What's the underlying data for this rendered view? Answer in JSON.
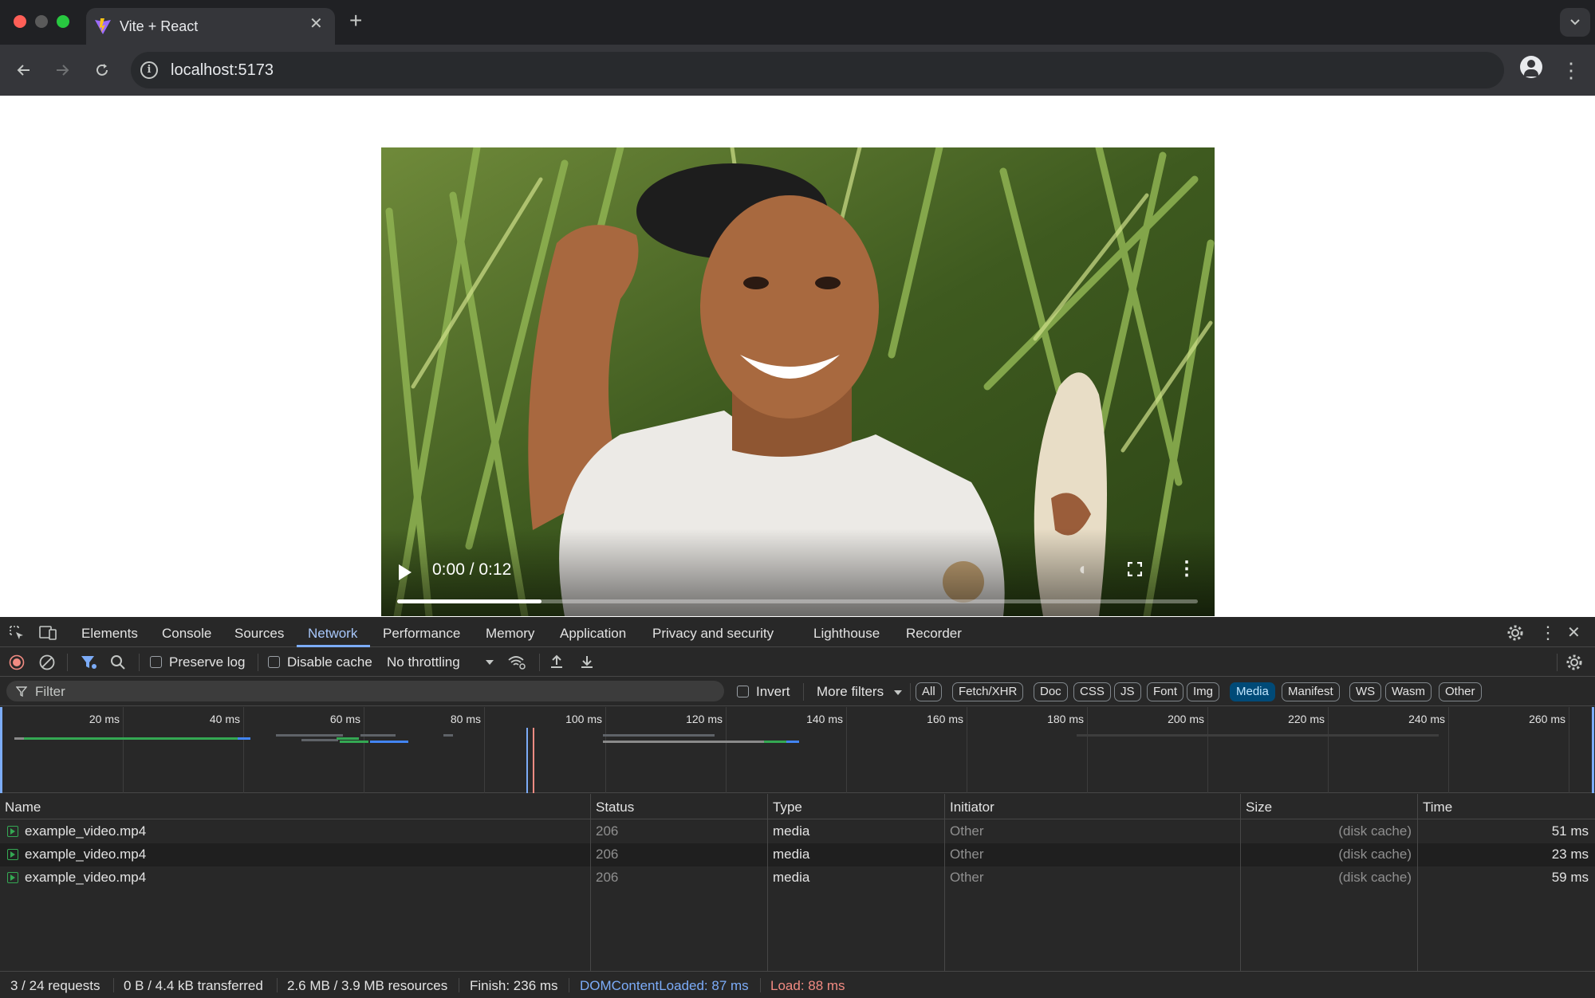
{
  "tab": {
    "title": "Vite + React",
    "close": "✕"
  },
  "new_tab": "+",
  "address": {
    "url": "localhost:5173"
  },
  "video": {
    "time": "0:00 / 0:12",
    "progress_buffered": 0.18
  },
  "devtools": {
    "tabs": [
      "Elements",
      "Console",
      "Sources",
      "Network",
      "Performance",
      "Memory",
      "Application",
      "Privacy and security",
      "Lighthouse",
      "Recorder"
    ],
    "active_tab": "Network",
    "toolbar": {
      "preserve_log": "Preserve log",
      "disable_cache": "Disable cache",
      "throttling": "No throttling"
    },
    "filter": {
      "placeholder": "Filter",
      "invert": "Invert",
      "more_filters": "More filters",
      "types": [
        "All",
        "Fetch/XHR",
        "Doc",
        "CSS",
        "JS",
        "Font",
        "Img",
        "Media",
        "Manifest",
        "WS",
        "Wasm",
        "Other"
      ],
      "active_type": "Media"
    },
    "timeline": {
      "ticks": [
        "20 ms",
        "40 ms",
        "60 ms",
        "80 ms",
        "100 ms",
        "120 ms",
        "140 ms",
        "160 ms",
        "180 ms",
        "200 ms",
        "220 ms",
        "240 ms",
        "260 ms"
      ],
      "dom_content_loaded_ms": 87,
      "load_ms": 88,
      "colors": {
        "dcl": "#7cacf8",
        "load": "#f28b82"
      }
    },
    "table": {
      "columns": [
        "Name",
        "Status",
        "Type",
        "Initiator",
        "Size",
        "Time"
      ],
      "rows": [
        {
          "name": "example_video.mp4",
          "status": "206",
          "type": "media",
          "initiator": "Other",
          "size": "(disk cache)",
          "time": "51 ms"
        },
        {
          "name": "example_video.mp4",
          "status": "206",
          "type": "media",
          "initiator": "Other",
          "size": "(disk cache)",
          "time": "23 ms"
        },
        {
          "name": "example_video.mp4",
          "status": "206",
          "type": "media",
          "initiator": "Other",
          "size": "(disk cache)",
          "time": "59 ms"
        }
      ]
    },
    "status_bar": {
      "requests": "3 / 24 requests",
      "transferred": "0 B / 4.4 kB transferred",
      "resources": "2.6 MB / 3.9 MB resources",
      "finish": "Finish: 236 ms",
      "dcl": "DOMContentLoaded: 87 ms",
      "load": "Load: 88 ms"
    }
  }
}
